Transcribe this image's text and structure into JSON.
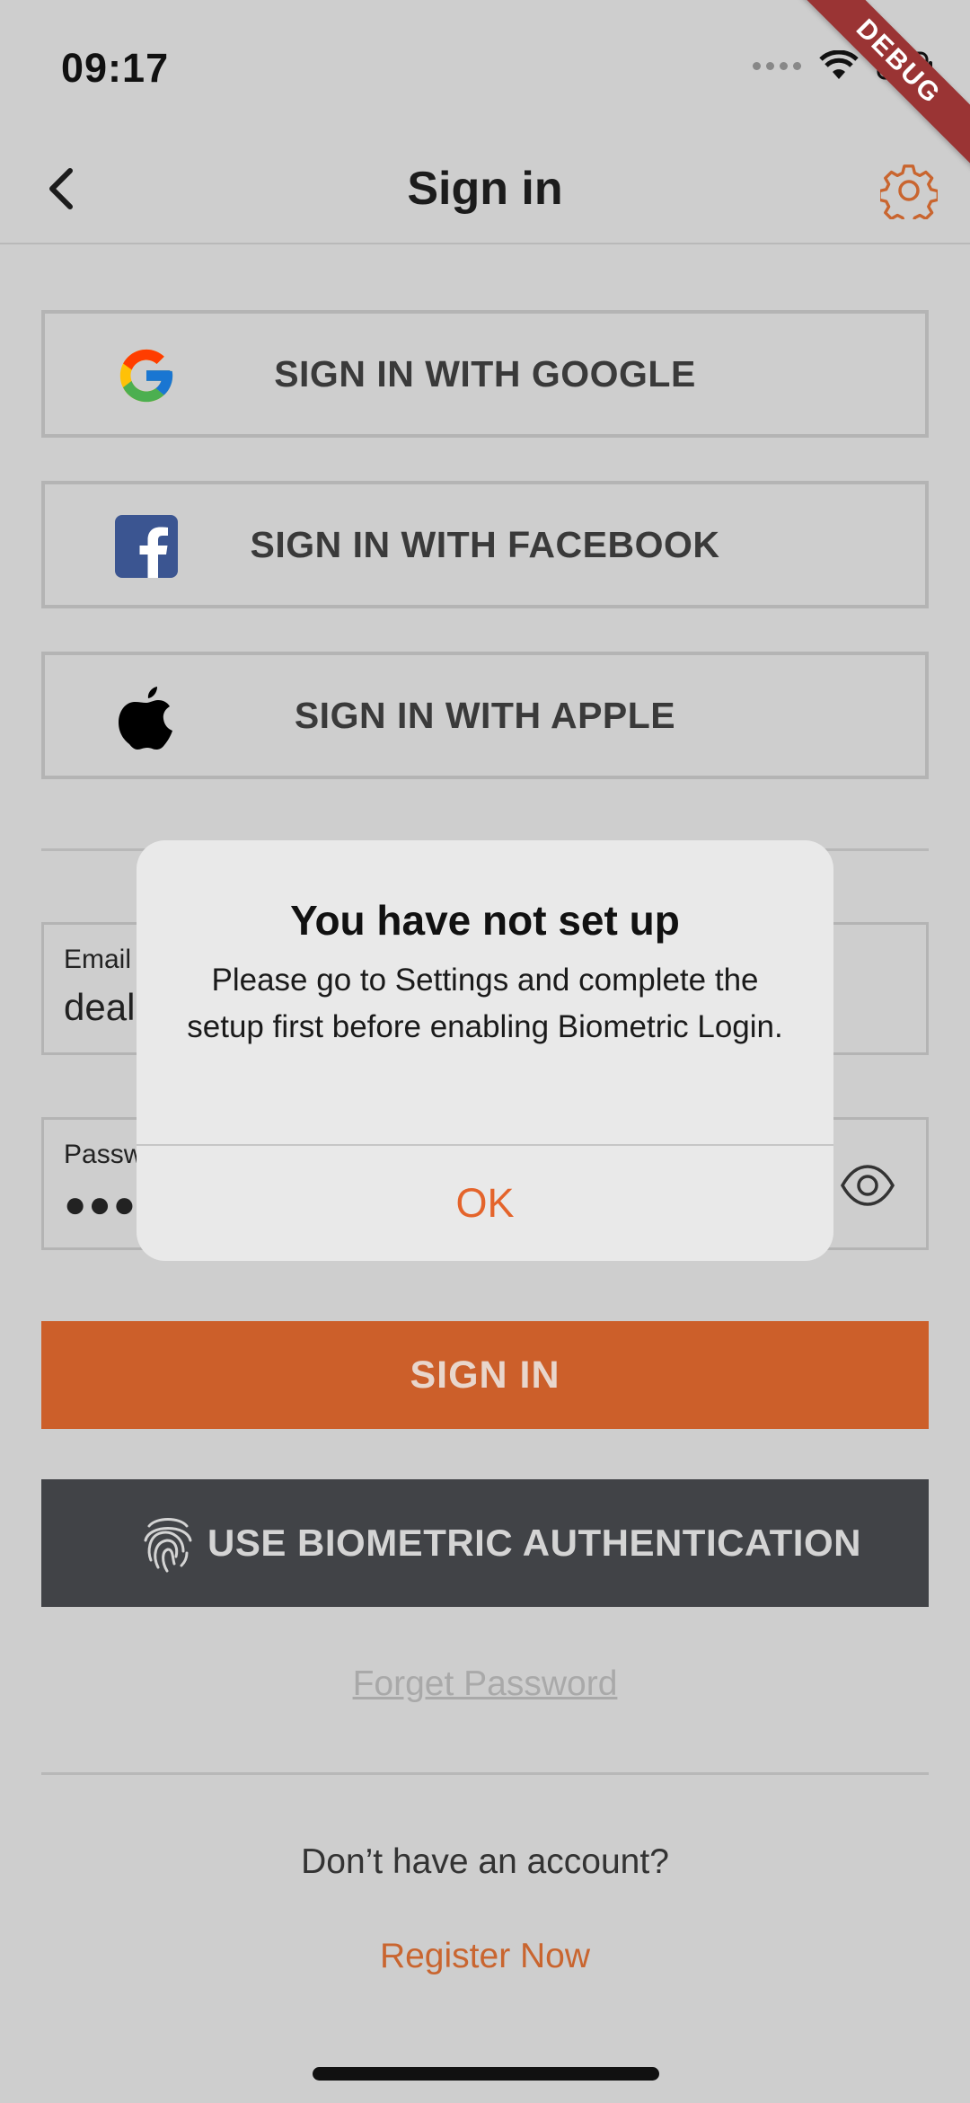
{
  "status_bar": {
    "time": "09:17",
    "debug_banner": "DEBUG"
  },
  "app_bar": {
    "title": "Sign in"
  },
  "social": {
    "google_label": "SIGN IN WITH GOOGLE",
    "facebook_label": "SIGN IN WITH FACEBOOK",
    "apple_label": "SIGN IN WITH APPLE"
  },
  "form": {
    "email_label": "Email",
    "email_value": "deale",
    "password_label": "Password",
    "password_dots": "●●●●"
  },
  "actions": {
    "sign_in_label": "SIGN IN",
    "biometric_label": "USE BIOMETRIC AUTHENTICATION",
    "forget_password": "Forget Password",
    "no_account": "Don’t have an account?",
    "register": "Register Now"
  },
  "dialog": {
    "title": "You have not set up",
    "message": "Please go to Settings and complete the setup first before enabling Biometric Login.",
    "ok_label": "OK"
  },
  "colors": {
    "accent": "#cc5f2a",
    "link": "#c9652f",
    "dialog_ok": "#e4642b",
    "biometric_bg": "#414347",
    "overlay_bg": "#cecece",
    "facebook": "#3b5591"
  },
  "icons": [
    "back-chevron-icon",
    "gear-icon",
    "google-icon",
    "facebook-icon",
    "apple-icon",
    "eye-icon",
    "fingerprint-icon",
    "wifi-icon",
    "battery-icon",
    "signal-icon"
  ]
}
